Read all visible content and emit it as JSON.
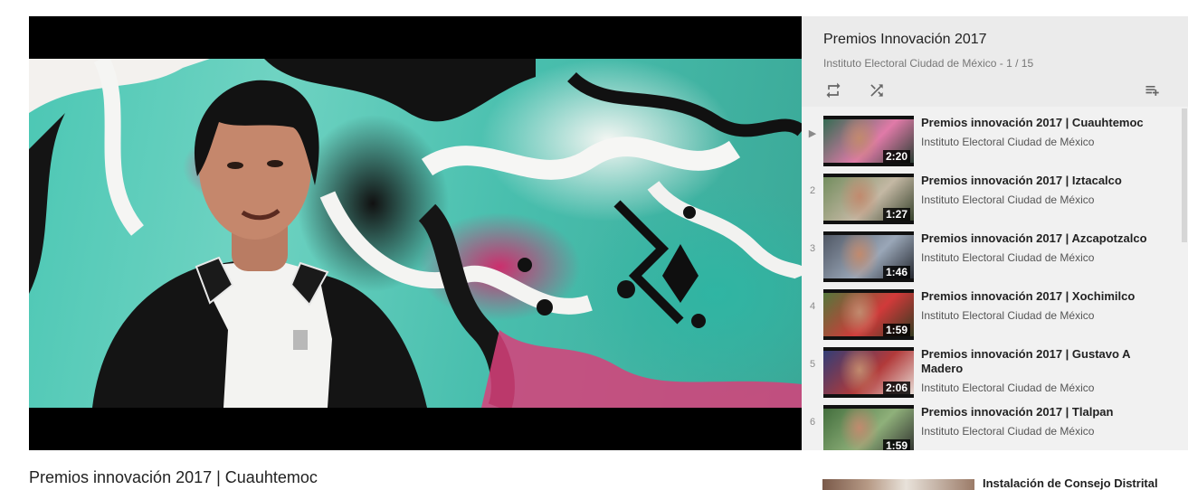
{
  "player": {
    "video_title": "Premios innovación 2017 | Cuauhtemoc"
  },
  "playlist": {
    "title": "Premios Innovación 2017",
    "subtitle": "Instituto Electoral Ciudad de México - 1 / 15",
    "controls": {
      "loop_icon": "loop-icon",
      "shuffle_icon": "shuffle-icon",
      "save_icon": "playlist-add-icon"
    },
    "items": [
      {
        "index": "▶",
        "title": "Premios innovación 2017 | Cuauhtemoc",
        "channel": "Instituto Electoral Ciudad de México",
        "duration": "2:20",
        "thumb_colors": [
          "#2c6b4f",
          "#e07aa8",
          "#1f3a2c"
        ]
      },
      {
        "index": "2",
        "title": "Premios innovación 2017 | Iztacalco",
        "channel": "Instituto Electoral Ciudad de México",
        "duration": "1:27",
        "thumb_colors": [
          "#6f8b5b",
          "#c4b8a4",
          "#2d3a24"
        ]
      },
      {
        "index": "3",
        "title": "Premios innovación 2017 | Azcapotzalco",
        "channel": "Instituto Electoral Ciudad de México",
        "duration": "1:46",
        "thumb_colors": [
          "#4c5360",
          "#9aa7b8",
          "#1d2027"
        ]
      },
      {
        "index": "4",
        "title": "Premios innovación 2017 | Xochimilco",
        "channel": "Instituto Electoral Ciudad de México",
        "duration": "1:59",
        "thumb_colors": [
          "#4e7a3b",
          "#d13a3a",
          "#2a3b1f"
        ]
      },
      {
        "index": "5",
        "title": "Premios innovación 2017 | Gustavo A Madero",
        "channel": "Instituto Electoral Ciudad de México",
        "duration": "2:06",
        "thumb_colors": [
          "#2c3e7a",
          "#b23a3a",
          "#e9e4dd"
        ]
      },
      {
        "index": "6",
        "title": "Premios innovación 2017 | Tlalpan",
        "channel": "Instituto Electoral Ciudad de México",
        "duration": "1:59",
        "thumb_colors": [
          "#3f6b3a",
          "#8fb07a",
          "#2a2a2a"
        ]
      }
    ]
  },
  "related": {
    "title": "Instalación de Consejo Distrital"
  },
  "colors": {
    "panel_bg": "#f1f1f1",
    "header_bg": "#ebebeb",
    "duration_bg": "#000000"
  }
}
